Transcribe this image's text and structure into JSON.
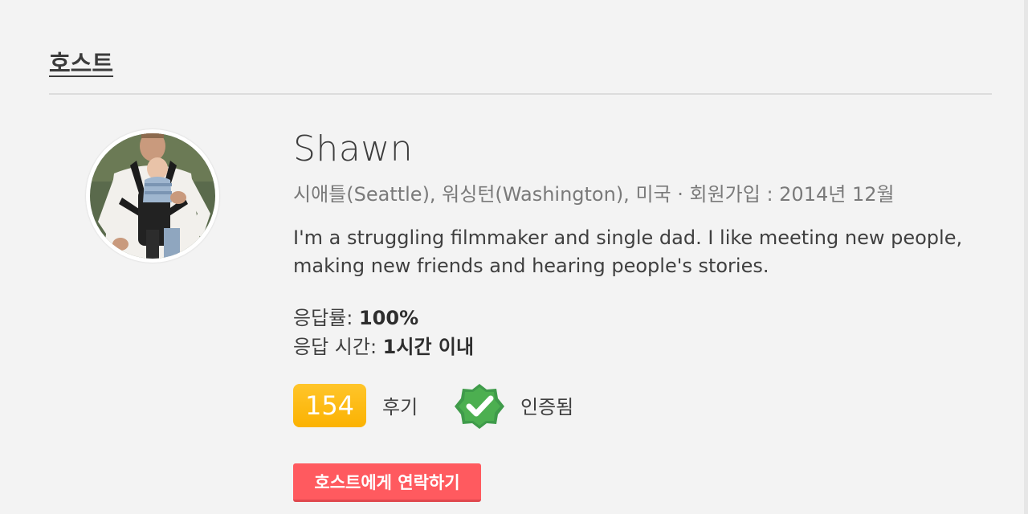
{
  "section": {
    "title": "호스트"
  },
  "host": {
    "name": "Shawn",
    "meta": "시애틀(Seattle), 워싱턴(Washington), 미국 · 회원가입 : 2014년 12월",
    "bio": "I'm a struggling filmmaker and single dad. I like meeting new people, making new friends and hearing people's stories.",
    "avatar_icon": "host-profile-photo"
  },
  "stats": {
    "response_rate_label": "응답률: ",
    "response_rate_value": "100%",
    "response_time_label": "응답 시간: ",
    "response_time_value": "1시간 이내"
  },
  "badges": {
    "review_count": "154",
    "review_label": "후기",
    "verified_label": "인증됨",
    "verified_icon": "check-badge-icon"
  },
  "actions": {
    "contact_label": "호스트에게 연락하기"
  },
  "colors": {
    "background": "#f3f3f3",
    "review_badge": "#ffb400",
    "verified_green": "#4caf50",
    "contact_button": "#ff5a5f"
  }
}
